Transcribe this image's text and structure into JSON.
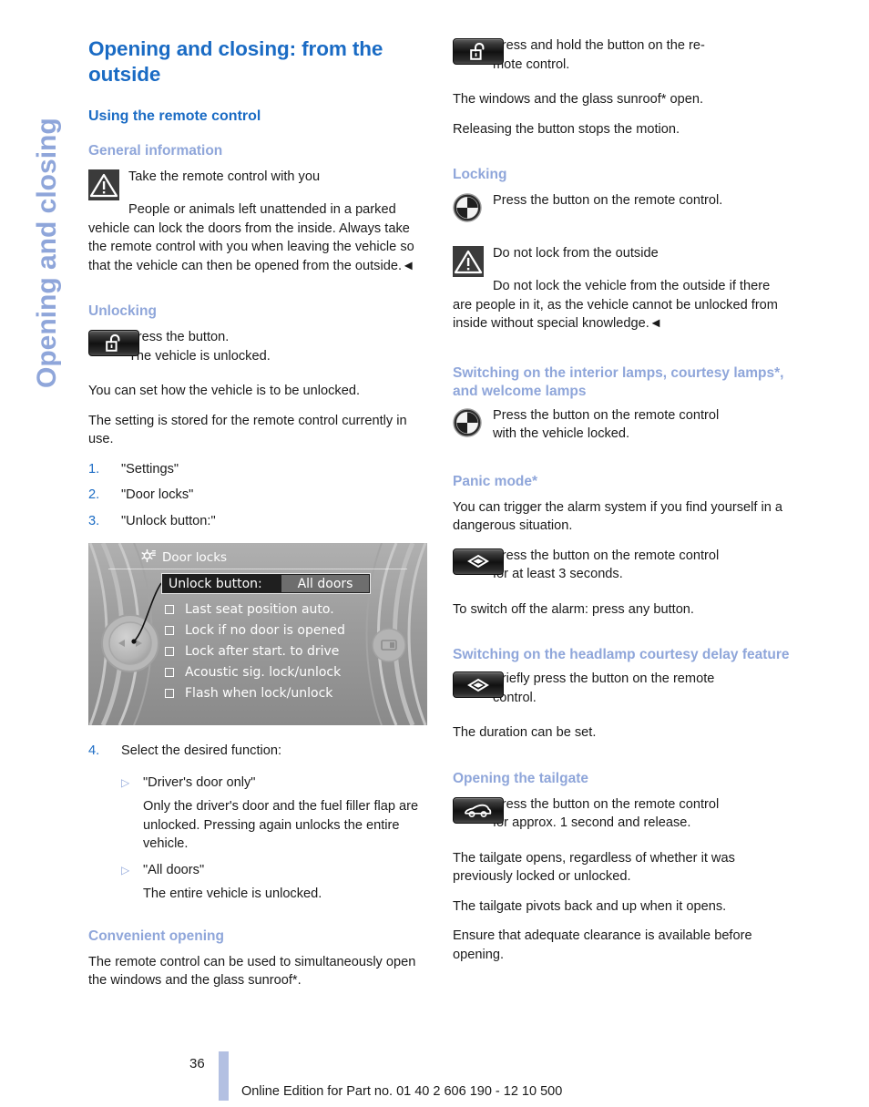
{
  "chapter_tab": {
    "label": "Opening and closing",
    "color": "#8fa6da"
  },
  "colors": {
    "title_blue": "#1a6bc4",
    "subhead_blue": "#8fa6da",
    "footer_bar": "#b3c0e2"
  },
  "left_column": {
    "title": "Opening and closing: from the outside",
    "section": "Using the remote control",
    "general": {
      "heading": "General information",
      "warn_title": "Take the remote control with you",
      "warn_body": "People or animals left unattended in a parked vehicle can lock the doors from the inside. Always take the remote control with you when leaving the vehicle so that the vehicle can then be opened from the outside.◄"
    },
    "unlocking": {
      "heading": "Unlocking",
      "icon": "unlock-key-button-icon",
      "icon_line1": "Press the button.",
      "icon_line2": "The vehicle is unlocked.",
      "para1": "You can set how the vehicle is to be unlocked.",
      "para2": "The setting is stored for the remote control currently in use.",
      "steps": [
        {
          "num": "1.",
          "text": "\"Settings\""
        },
        {
          "num": "2.",
          "text": "\"Door locks\""
        },
        {
          "num": "3.",
          "text": "\"Unlock button:\""
        }
      ],
      "step4": {
        "num": "4.",
        "text": "Select the desired function:"
      },
      "options": [
        {
          "marker": "▷",
          "label": "\"Driver's door only\"",
          "detail": "Only the driver's door and the fuel filler flap are unlocked. Pressing again unlocks the entire vehicle."
        },
        {
          "marker": "▷",
          "label": "\"All doors\"",
          "detail": "The entire vehicle is unlocked."
        }
      ]
    },
    "idrive_screen": {
      "gear_icon": "settings-gear-icon",
      "header": "Door locks",
      "selected_row_label": "Unlock button:",
      "selected_row_value": "All doors",
      "options": [
        "Last seat position auto.",
        "Lock if no door is opened",
        "Lock after start. to drive",
        "Acoustic sig. lock/unlock",
        "Flash when lock/unlock"
      ]
    },
    "convenient": {
      "heading": "Convenient opening",
      "para": "The remote control can be used to simultaneously open the windows and the glass sunroof*."
    }
  },
  "right_column": {
    "convenient_cont": {
      "icon": "unlock-key-button-icon",
      "icon_line1": "Press and hold the button on the re-",
      "icon_line2": "mote control.",
      "para1": "The windows and the glass sunroof* open.",
      "para2": "Releasing the button stops the motion."
    },
    "locking": {
      "heading": "Locking",
      "icon": "bmw-roundel-icon",
      "icon_text": "Press the button on the remote control.",
      "warn_title": "Do not lock from the outside",
      "warn_body": "Do not lock the vehicle from the outside if there are people in it, as the vehicle cannot be unlocked from inside without special knowledge.◄"
    },
    "interior_lamps": {
      "heading": "Switching on the interior lamps, courtesy lamps*, and welcome lamps",
      "icon": "bmw-roundel-icon",
      "icon_line1": "Press the button on the remote control",
      "icon_line2": "with the vehicle locked."
    },
    "panic": {
      "heading": "Panic mode*",
      "para": "You can trigger the alarm system if you find yourself in a dangerous situation.",
      "icon": "panic-diamond-button-icon",
      "icon_line1": "Press the button on the remote control",
      "icon_line2": "for at least 3 seconds.",
      "after": "To switch off the alarm: press any button."
    },
    "headlamp": {
      "heading": "Switching on the headlamp courtesy delay feature",
      "icon": "panic-diamond-button-icon",
      "icon_line1": "Briefly press the button on the remote",
      "icon_line2": "control.",
      "after": "The duration can be set."
    },
    "tailgate": {
      "heading": "Opening the tailgate",
      "icon": "tailgate-car-button-icon",
      "icon_line1": "Press the button on the remote control",
      "icon_line2": "for approx. 1 second and release.",
      "para1": "The tailgate opens, regardless of whether it was previously locked or unlocked.",
      "para2": "The tailgate pivots back and up when it opens.",
      "para3": "Ensure that adequate clearance is available before opening."
    }
  },
  "footer": {
    "page_number": "36",
    "edition": "Online Edition for Part no. 01 40 2 606 190 - 12 10 500"
  }
}
